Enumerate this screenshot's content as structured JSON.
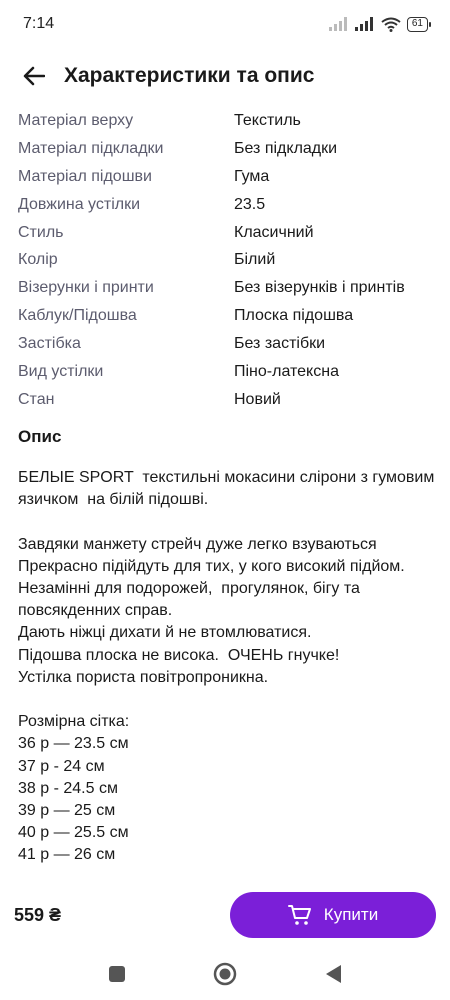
{
  "status_bar": {
    "time": "7:14",
    "battery": "61"
  },
  "header": {
    "title": "Характеристики та опис"
  },
  "specs": [
    {
      "key": "Матеріал верху",
      "value": "Текстиль"
    },
    {
      "key": "Матеріал підкладки",
      "value": "Без підкладки"
    },
    {
      "key": "Матеріал підошви",
      "value": "Гума"
    },
    {
      "key": "Довжина устілки",
      "value": "23.5"
    },
    {
      "key": "Стиль",
      "value": "Класичний"
    },
    {
      "key": "Колір",
      "value": "Білий"
    },
    {
      "key": "Візерунки і принти",
      "value": "Без візерунків і принтів"
    },
    {
      "key": "Каблук/Підошва",
      "value": "Плоска підошва"
    },
    {
      "key": "Застібка",
      "value": "Без застібки"
    },
    {
      "key": "Вид устілки",
      "value": "Піно-латексна"
    },
    {
      "key": "Стан",
      "value": "Новий"
    }
  ],
  "description": {
    "title": "Опис",
    "text": "БЕЛЫЕ SPORT  текстильні мокасини слipони з гумовим язичком  на білій підошві.\n\nЗавдяки манжету стрейч дуже легко взуваються\nПрекрасно підійдуть для тих, у кого високий підйом.\nНезамінні для подорожей,  прогулянок, бігу та повсякденних справ.\nДають ніжці дихати й не втомлюватися.\nПідошва плоска не висока.  ОЧЕНЬ гнучке!\nУстілка пориста повітропроникна.\n\nРозмірна сітка:\n36 р — 23.5 см\n37 р - 24 см\n38 р - 24.5 см\n39 р — 25 см\n40 р — 25.5 см\n41 р — 26 см"
  },
  "purchase": {
    "price": "559 ₴",
    "buy_label": "Купити"
  },
  "colors": {
    "accent": "#7b1fd8",
    "label_gray": "#5c5c6e"
  }
}
